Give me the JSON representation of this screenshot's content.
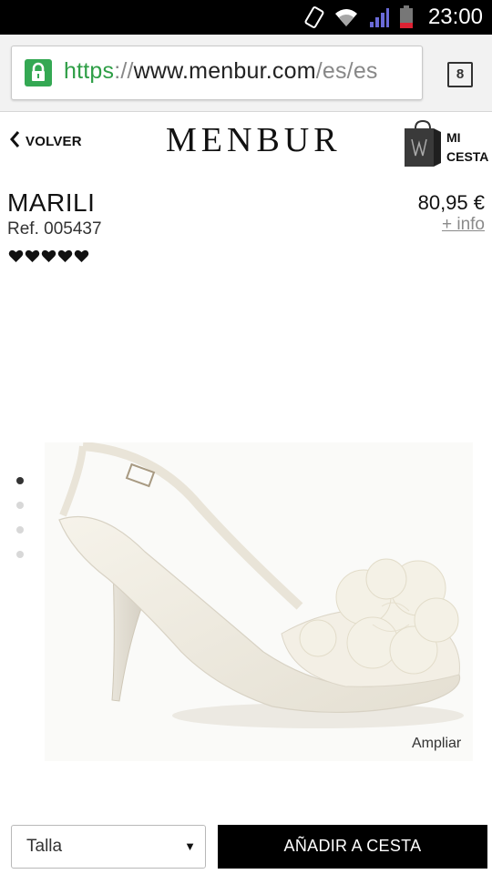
{
  "status_bar": {
    "time": "23:00",
    "icons": [
      "rotation-lock-icon",
      "wifi-icon",
      "signal-icon",
      "battery-icon"
    ]
  },
  "browser": {
    "url_scheme": "https",
    "url_separator": "://",
    "url_host": "www.menbur.com",
    "url_path": "/es/es",
    "tab_count": "8",
    "secure_color": "#34a853"
  },
  "site_header": {
    "back_label": "VOLVER",
    "logo": "MENBUR",
    "cart_line1": "MI",
    "cart_line2": "CESTA"
  },
  "product": {
    "name": "MARILI",
    "ref": "Ref. 005437",
    "rating": 5,
    "price": "80,95 €",
    "more_info": "+ info",
    "zoom_label": "Ampliar",
    "gallery_count": 4,
    "gallery_active": 1
  },
  "purchase": {
    "size_placeholder": "Talla",
    "add_button": "AÑADIR A CESTA"
  }
}
